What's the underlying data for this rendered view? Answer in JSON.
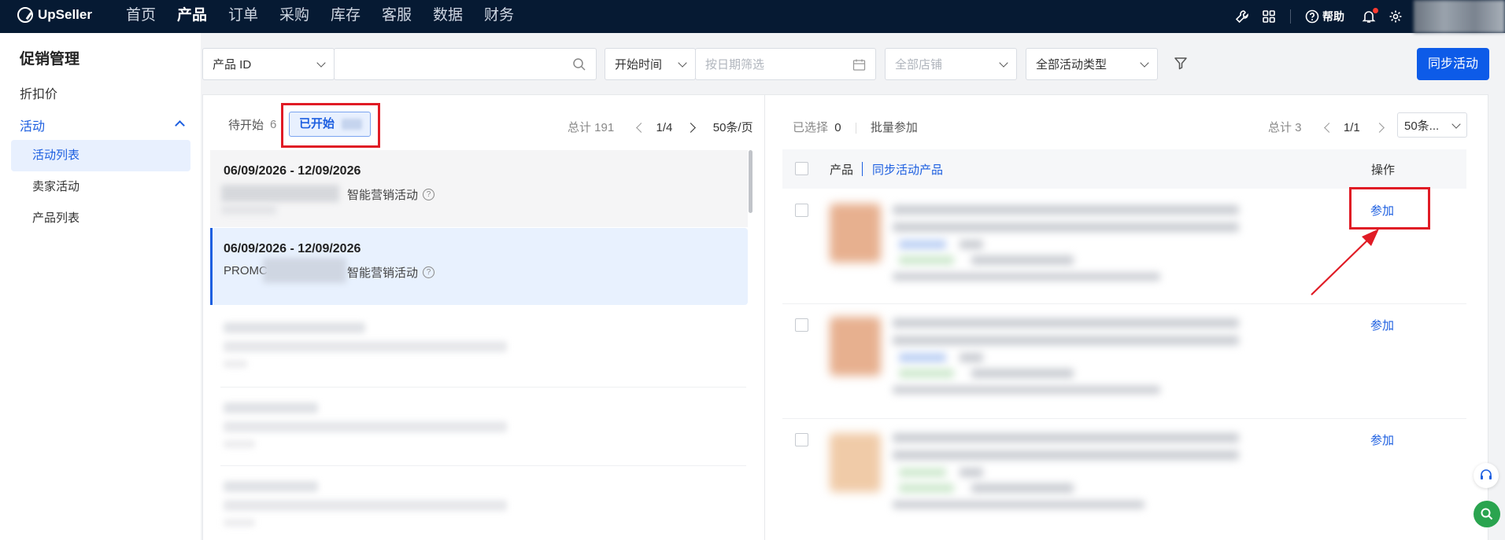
{
  "brand": {
    "name": "UpSeller"
  },
  "nav": {
    "items": [
      "首页",
      "产品",
      "订单",
      "采购",
      "库存",
      "客服",
      "数据",
      "财务"
    ],
    "active": "产品",
    "help_label": "帮助",
    "icons": [
      "wrench-icon",
      "grid-icon",
      "help-icon",
      "bell-icon",
      "gear-icon"
    ]
  },
  "sidebar": {
    "title": "促销管理",
    "items": {
      "discount": "折扣价",
      "activity": "活动"
    },
    "sub_items": [
      "活动列表",
      "卖家活动",
      "产品列表"
    ],
    "active_sub": "活动列表"
  },
  "filters": {
    "id_type": "产品 ID",
    "search_value": "",
    "time_type": "开始时间",
    "date_placeholder": "按日期筛选",
    "store": "全部店铺",
    "activity_type": "全部活动类型",
    "sync_button": "同步活动"
  },
  "left_panel": {
    "tab_pending": "待开始",
    "tab_pending_count": "6",
    "tab_started": "已开始",
    "total": "总计 191",
    "page": "1/4",
    "page_size": "50条/页",
    "activities": [
      {
        "date_range": "06/09/2026 - 12/09/2026",
        "name": "",
        "type": "智能营销活动"
      },
      {
        "date_range": "06/09/2026 - 12/09/2026",
        "name": "PROMC",
        "type": "智能营销活动"
      }
    ]
  },
  "right_panel": {
    "selected_label": "已选择",
    "selected_count": "0",
    "batch_join": "批量参加",
    "total": "总计 3",
    "page": "1/1",
    "page_size": "50条...",
    "columns": {
      "product": "产品",
      "sync_products": "同步活动产品",
      "action": "操作"
    },
    "rows": [
      {
        "action": "参加"
      },
      {
        "action": "参加"
      },
      {
        "action": "参加"
      }
    ]
  },
  "colors": {
    "nav_bg": "#061a33",
    "accent": "#0d5be8",
    "highlight": "#e01b25"
  }
}
